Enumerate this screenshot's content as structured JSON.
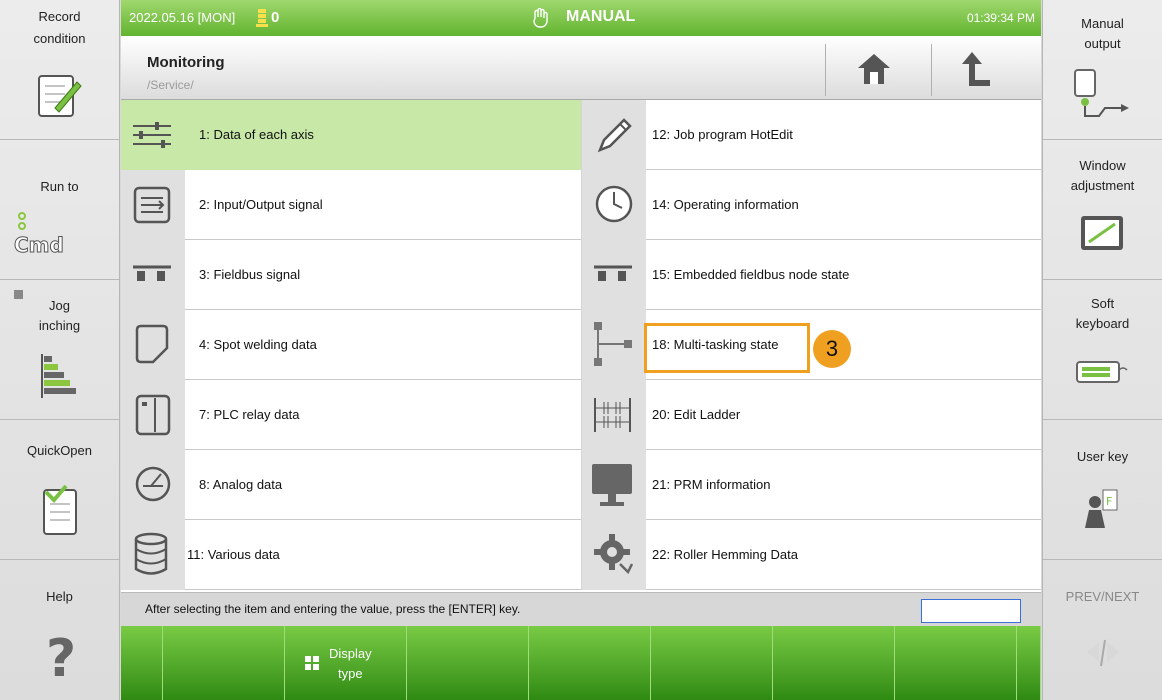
{
  "left_panel": [
    {
      "label": "Record\ncondition",
      "icon": "record-notepad-icon"
    },
    {
      "label": "Run to",
      "icon": "cmd-icon"
    },
    {
      "label": "Jog\ninching",
      "icon": "jog-bars-icon"
    },
    {
      "label": "QuickOpen",
      "icon": "checklist-icon"
    },
    {
      "label": "Help",
      "icon": "question-icon"
    }
  ],
  "right_panel": [
    {
      "label": "Manual\noutput",
      "icon": "manual-output-icon"
    },
    {
      "label": "Window\nadjustment",
      "icon": "window-adjust-icon"
    },
    {
      "label": "Soft\nkeyboard",
      "icon": "keyboard-icon"
    },
    {
      "label": "User key",
      "icon": "user-key-icon"
    },
    {
      "label": "PREV/NEXT",
      "icon": "prev-next-icon"
    }
  ],
  "topbar": {
    "date": "2022.05.16 [MON]",
    "count": "0",
    "mode": "MANUAL",
    "time": "01:39:34 PM"
  },
  "header": {
    "title": "Monitoring",
    "path": "/Service/"
  },
  "menu": {
    "left": [
      {
        "label": "1: Data of each axis",
        "icon": "axis-sliders-icon",
        "selected": true
      },
      {
        "label": "2: Input/Output signal",
        "icon": "io-signal-icon"
      },
      {
        "label": "3: Fieldbus signal",
        "icon": "fieldbus-icon"
      },
      {
        "label": "4: Spot welding data",
        "icon": "spot-welding-icon"
      },
      {
        "label": "7: PLC relay data",
        "icon": "plc-relay-icon"
      },
      {
        "label": "8: Analog data",
        "icon": "analog-gauge-icon"
      },
      {
        "label": "11: Various data",
        "icon": "database-icon"
      }
    ],
    "right": [
      {
        "label": "12: Job program HotEdit",
        "icon": "pencil-icon"
      },
      {
        "label": "14: Operating information",
        "icon": "clock-icon"
      },
      {
        "label": "15: Embedded fieldbus node state",
        "icon": "fieldbus-node-icon"
      },
      {
        "label": "18: Multi-tasking state",
        "icon": "multitask-icon"
      },
      {
        "label": "20: Edit Ladder",
        "icon": "ladder-icon"
      },
      {
        "label": "21: PRM information",
        "icon": "monitor-icon"
      },
      {
        "label": "22: Roller Hemming Data",
        "icon": "gear-icon"
      }
    ]
  },
  "annotation": {
    "badge": "3",
    "color": "#f0a020"
  },
  "status": {
    "message": "After selecting the item and entering the value, press the [ENTER] key.",
    "input_value": ""
  },
  "fkeys": {
    "display_type": "Display\ntype"
  },
  "colors": {
    "accent_green": "#62b42f",
    "selected_row": "#c8e8a8"
  }
}
